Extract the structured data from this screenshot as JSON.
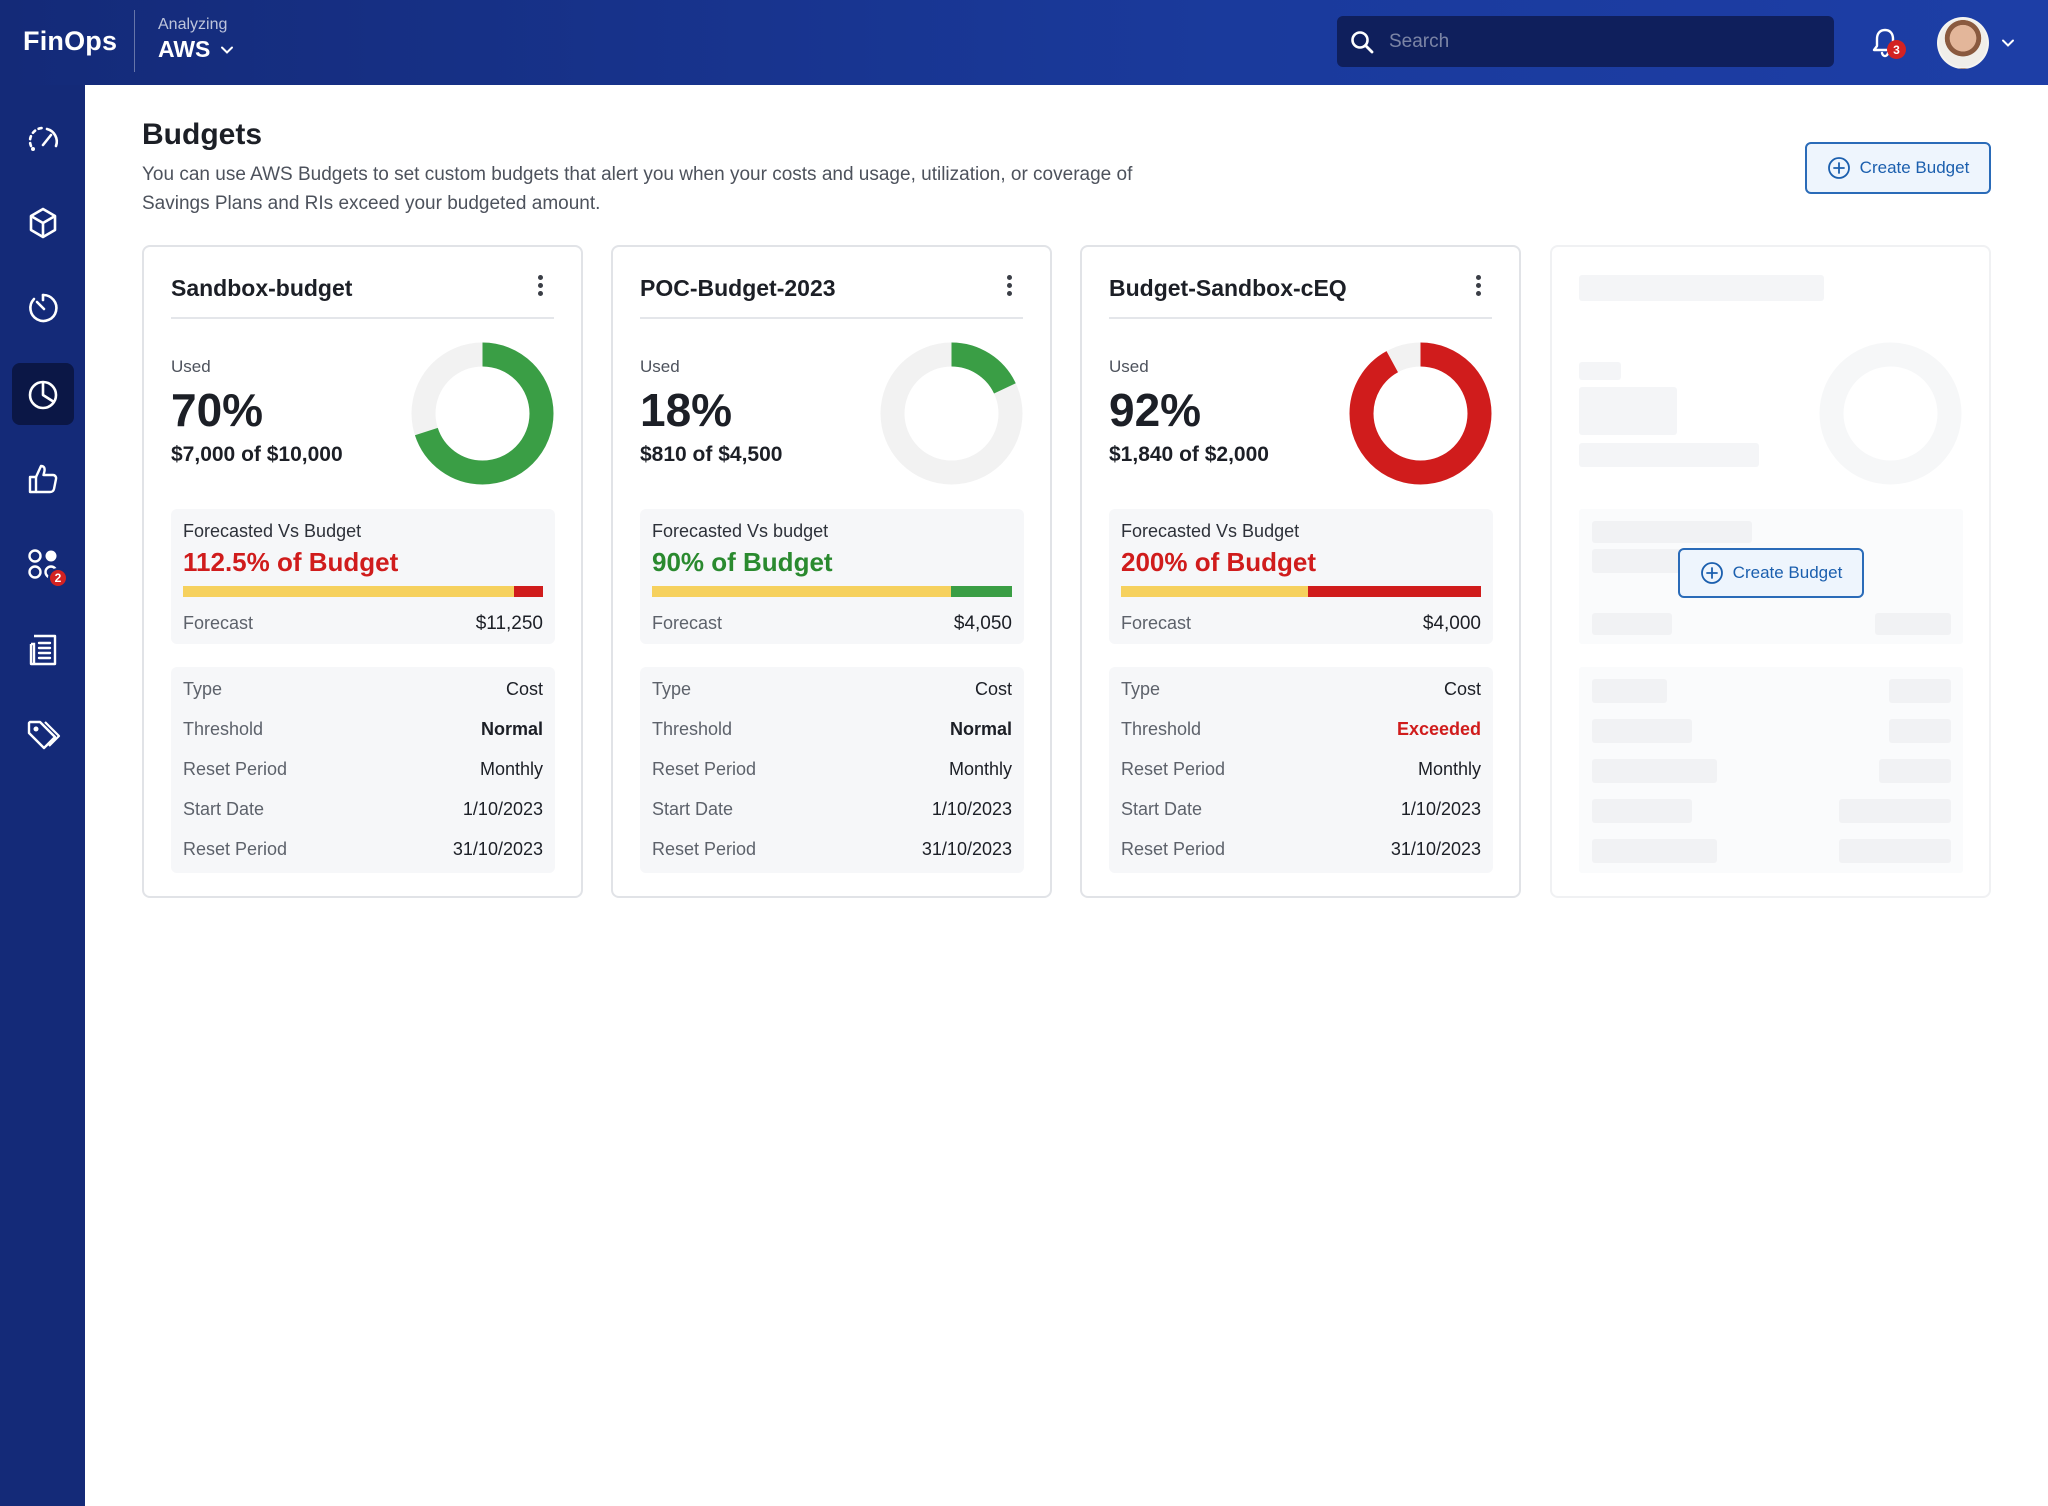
{
  "header": {
    "logo": "FinOps",
    "analyzing_label": "Analyzing",
    "provider": "AWS",
    "search_placeholder": "Search",
    "notifications_count": "3"
  },
  "sidebar": {
    "items": [
      {
        "icon": "speedometer-icon"
      },
      {
        "icon": "cube-icon"
      },
      {
        "icon": "timer-icon"
      },
      {
        "icon": "pie-chart-icon",
        "active": true
      },
      {
        "icon": "thumbs-up-icon"
      },
      {
        "icon": "apps-icon",
        "badge": "2"
      },
      {
        "icon": "report-icon"
      },
      {
        "icon": "tags-icon"
      }
    ]
  },
  "page": {
    "title": "Budgets",
    "description": "You can use AWS Budgets to set custom budgets that alert you when your costs and usage, utilization, or coverage of Savings Plans and RIs exceed your budgeted amount.",
    "create_button": "Create Budget"
  },
  "colors": {
    "green": "#3a9e45",
    "red": "#d01c1c",
    "yellow": "#f6d15e",
    "track": "#f2f2f2",
    "accent": "#1b5fae"
  },
  "cards": [
    {
      "name": "Sandbox-budget",
      "used_label": "Used",
      "used_pct": "70%",
      "used_fraction": 0.7,
      "used_amount": "$7,000 of $10,000",
      "donut_color": "#3a9e45",
      "forecast_title": "Forecasted Vs Budget",
      "forecast_value": "112.5% of Budget",
      "forecast_color": "#d01c1c",
      "bar_yellow_fraction": 0.92,
      "bar_end_color": "#d01c1c",
      "forecast_label": "Forecast",
      "forecast_amount": "$11,250",
      "details": [
        {
          "k": "Type",
          "v": "Cost"
        },
        {
          "k": "Threshold",
          "v": "Normal",
          "bold": true
        },
        {
          "k": "Reset Period",
          "v": "Monthly"
        },
        {
          "k": "Start Date",
          "v": "1/10/2023"
        },
        {
          "k": "Reset Period",
          "v": "31/10/2023"
        }
      ]
    },
    {
      "name": "POC-Budget-2023",
      "used_label": "Used",
      "used_pct": "18%",
      "used_fraction": 0.18,
      "used_amount": "$810 of $4,500",
      "donut_color": "#3a9e45",
      "forecast_title": "Forecasted Vs budget",
      "forecast_value": "90% of Budget",
      "forecast_color": "#2a8a2f",
      "bar_yellow_fraction": 0.83,
      "bar_end_color": "#3a9e45",
      "forecast_label": "Forecast",
      "forecast_amount": "$4,050",
      "details": [
        {
          "k": "Type",
          "v": "Cost"
        },
        {
          "k": "Threshold",
          "v": "Normal",
          "bold": true
        },
        {
          "k": "Reset Period",
          "v": "Monthly"
        },
        {
          "k": "Start Date",
          "v": "1/10/2023"
        },
        {
          "k": "Reset Period",
          "v": "31/10/2023"
        }
      ]
    },
    {
      "name": "Budget-Sandbox-cEQ",
      "used_label": "Used",
      "used_pct": "92%",
      "used_fraction": 0.92,
      "used_amount": "$1,840 of $2,000",
      "donut_color": "#d01c1c",
      "forecast_title": "Forecasted Vs Budget",
      "forecast_value": "200% of Budget",
      "forecast_color": "#d01c1c",
      "bar_yellow_fraction": 0.52,
      "bar_end_color": "#d01c1c",
      "forecast_label": "Forecast",
      "forecast_amount": "$4,000",
      "details": [
        {
          "k": "Type",
          "v": "Cost"
        },
        {
          "k": "Threshold",
          "v": "Exceeded",
          "bold": true,
          "color": "#d01c1c"
        },
        {
          "k": "Reset Period",
          "v": "Monthly"
        },
        {
          "k": "Start Date",
          "v": "1/10/2023"
        },
        {
          "k": "Reset Period",
          "v": "31/10/2023"
        }
      ]
    }
  ],
  "placeholder_card": {
    "create_button": "Create Budget"
  }
}
